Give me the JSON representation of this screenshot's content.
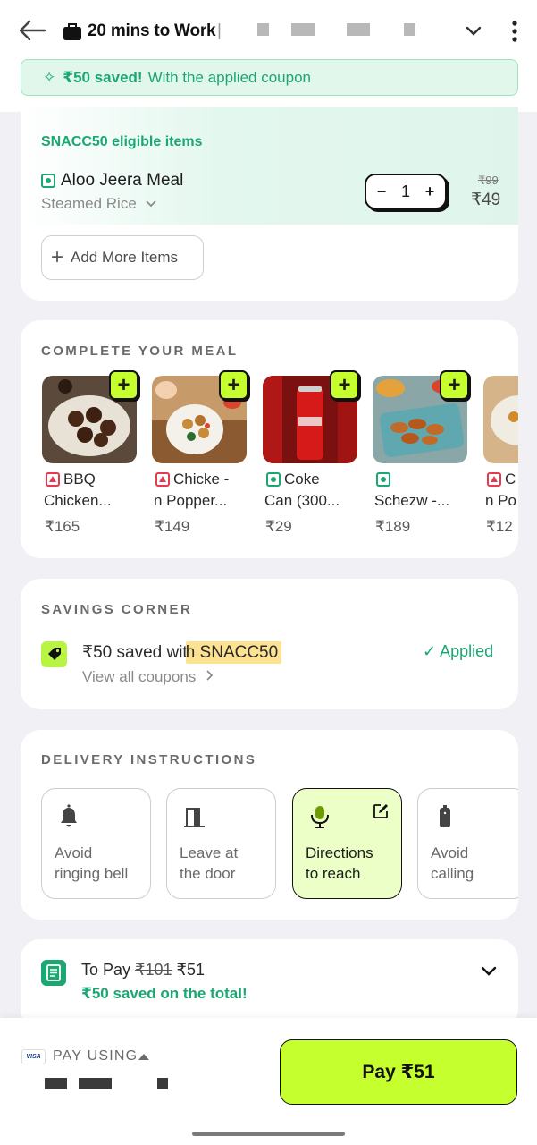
{
  "header": {
    "title": "20 mins to Work",
    "separator": "|",
    "banner_amount": "₹50 saved!",
    "banner_text": "With the applied coupon"
  },
  "eligible": {
    "title": "SNACC50 eligible items",
    "item_name": "Aloo Jeera Meal",
    "item_sub": "Steamed Rice",
    "qty": "1",
    "price_old": "₹99",
    "price_new": "₹49",
    "add_more": "Add More Items"
  },
  "meal": {
    "title": "COMPLETE YOUR MEAL",
    "items": [
      {
        "line1": "BBQ",
        "line2": "Chicken...",
        "price": "₹165",
        "type": "nonveg"
      },
      {
        "line1": "Chicke -",
        "line2": "n Popper...",
        "price": "₹149",
        "type": "nonveg"
      },
      {
        "line1": "Coke",
        "line2": "Can (300...",
        "price": "₹29",
        "type": "veg"
      },
      {
        "line1": "",
        "line2": "Schezw -...",
        "price": "₹189",
        "type": "veg"
      },
      {
        "line1": "C",
        "line2": "n Po",
        "price": "₹12",
        "type": "nonveg"
      }
    ]
  },
  "savings": {
    "title": "SAVINGS CORNER",
    "saved_prefix": "₹50 saved wit",
    "saved_hl": "h SNACC50",
    "view_all": "View all coupons",
    "applied": "✓ Applied"
  },
  "delivery": {
    "title": "DELIVERY INSTRUCTIONS",
    "tiles": [
      {
        "l1": "Avoid",
        "l2": "ringing bell",
        "icon": "bell-icon"
      },
      {
        "l1": "Leave at",
        "l2": "the door",
        "icon": "door-icon"
      },
      {
        "l1": "Directions",
        "l2": "to reach",
        "icon": "mic-icon"
      },
      {
        "l1": "Avoid",
        "l2": "calling",
        "icon": "phone-icon"
      }
    ]
  },
  "summary": {
    "to_pay_label": "To Pay",
    "old_total": "₹101",
    "new_total": "₹51",
    "saved_total": "₹50 saved on the total!"
  },
  "bottom": {
    "card_brand": "VISA",
    "pay_using": "PAY USING",
    "pay_button": "Pay ₹51"
  },
  "colors": {
    "accent_green": "#1ba672",
    "lime": "#c5ff2e",
    "highlight": "#fcd86e"
  }
}
